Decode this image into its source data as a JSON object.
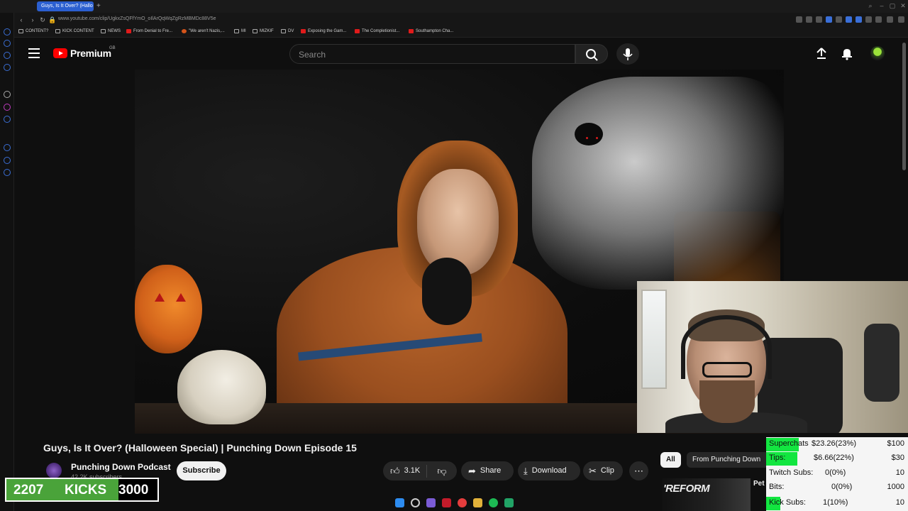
{
  "browser": {
    "active_tab": "Guys, Is It Over? (Hallo",
    "url": "www.youtube.com/clip/UgkxZsQFfYmO_oIlArQqWqZgRzMBMDc88V5e",
    "bookmarks": [
      "CONTENT?",
      "KICK CONTENT",
      "NEWS",
      "From Denial to Fre...",
      "\"We aren't Nazis,...",
      "MI",
      "MIZKIF",
      "DV",
      "Exposing the Gam...",
      "The Completionist...",
      "Southampton Cha..."
    ]
  },
  "youtube": {
    "logo_text": "Premium",
    "region": "GB",
    "search_placeholder": "Search"
  },
  "video": {
    "title": "Guys, Is It Over? (Halloween Special) | Punching Down Episode 15",
    "channel": "Punching Down Podcast",
    "subscribers": "42.2K subscribers",
    "subscribe_label": "Subscribe",
    "likes": "3.1K",
    "share_label": "Share",
    "download_label": "Download",
    "clip_label": "Clip",
    "more_label": "⋯"
  },
  "recommendations": {
    "chip_all": "All",
    "chip_from": "From Punching Down",
    "thumb_text": "'REFORM",
    "title_fragment": "Pet"
  },
  "kicks": {
    "current": "2207",
    "label": "KICKS",
    "goal": "3000",
    "progress_fraction": 0.74
  },
  "goals": [
    {
      "label": "Superchats",
      "value": "$23.26(23%)",
      "target": "$100",
      "fraction": 0.23
    },
    {
      "label": "Tips:",
      "value": "$6.66(22%)",
      "target": "$30",
      "fraction": 0.22
    },
    {
      "label": "Twitch Subs:",
      "value": "0(0%)",
      "target": "10",
      "fraction": 0.0
    },
    {
      "label": "Bits:",
      "value": "0(0%)",
      "target": "1000",
      "fraction": 0.0
    },
    {
      "label": "Kick Subs:",
      "value": "1(10%)",
      "target": "10",
      "fraction": 0.1
    }
  ],
  "colors": {
    "accent_red": "#ff0000",
    "goal_green": "#12e640",
    "kicks_green": "#4aa33a",
    "background": "#0f0f0f"
  }
}
